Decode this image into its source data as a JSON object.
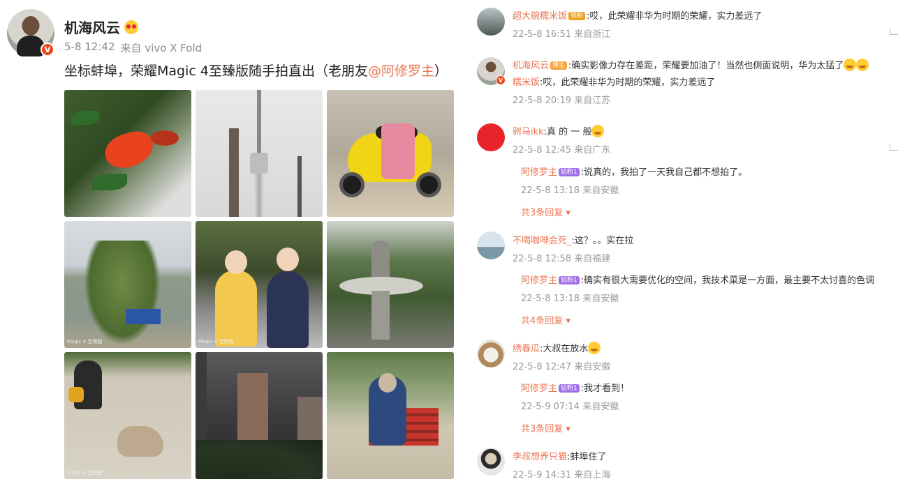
{
  "post": {
    "author": "机海风云",
    "date": "5-8 12:42",
    "source": "来自 vivo X Fold",
    "text_before": "坐标蚌埠，荣耀Magic 4至臻版随手拍直出（老朋友",
    "mention": "@阿修罗主",
    "text_after": "）",
    "verified_badge": "V",
    "accent": "#eb7350",
    "photo_watermark": "Magic 4 至臻版",
    "photos": [
      {
        "icon": "pomegranate-flower"
      },
      {
        "icon": "tv-tower"
      },
      {
        "icon": "yellow-scooter"
      },
      {
        "icon": "willow-tree"
      },
      {
        "icon": "two-children"
      },
      {
        "icon": "fountain"
      },
      {
        "icon": "dog-and-person"
      },
      {
        "icon": "high-rise-buildings"
      },
      {
        "icon": "man-on-bench"
      }
    ]
  },
  "comments": [
    {
      "name": "超大碗糯米饭",
      "badge": "铁粉",
      "text": ":哎，此荣耀非华为时期的荣耀，实力差远了",
      "time": "22-5-8 16:51",
      "location": "来自浙江"
    },
    {
      "name": "机海风云",
      "badge": "博主",
      "text": ":确实影像力存在差距，荣耀要加油了！当然也侧面说明，华为太猛了",
      "quote_name": "糯米饭",
      "quote_text": ":哎，此荣耀非华为时期的荣耀，实力差远了",
      "time": "22-5-8 20:19",
      "location": "来自江苏"
    },
    {
      "name": "驸马ikk",
      "text": ":真 的 一 般",
      "time": "22-5-8 12:45",
      "location": "来自广东",
      "reply": {
        "name": "阿修罗主",
        "badge": "钻粉1",
        "text": ":说真的，我拍了一天我自己都不想拍了。",
        "time": "22-5-8 13:18",
        "location": "来自安徽"
      },
      "more": "共3条回复"
    },
    {
      "name": "不喝咖啡会死_",
      "text": ":这？。。实在拉",
      "time": "22-5-8 12:58",
      "location": "来自福建",
      "reply": {
        "name": "阿修罗主",
        "badge": "钻粉1",
        "text": ":确实有很大需要优化的空间，我技术菜是一方面，最主要不太讨喜的色调",
        "time": "22-5-8 13:18",
        "location": "来自安徽"
      },
      "more": "共4条回复"
    },
    {
      "name": "绣春瓜",
      "text": ":大叔在放水",
      "time": "22-5-8 12:47",
      "location": "来自安徽",
      "reply": {
        "name": "阿修罗主",
        "badge": "钻粉1",
        "text": ":我才看到！",
        "time": "22-5-9 07:14",
        "location": "来自安徽"
      },
      "more": "共3条回复"
    },
    {
      "name": "李叔想养只猫",
      "text": ":蚌埠住了",
      "time": "22-5-9 14:31",
      "location": "来自上海"
    }
  ]
}
